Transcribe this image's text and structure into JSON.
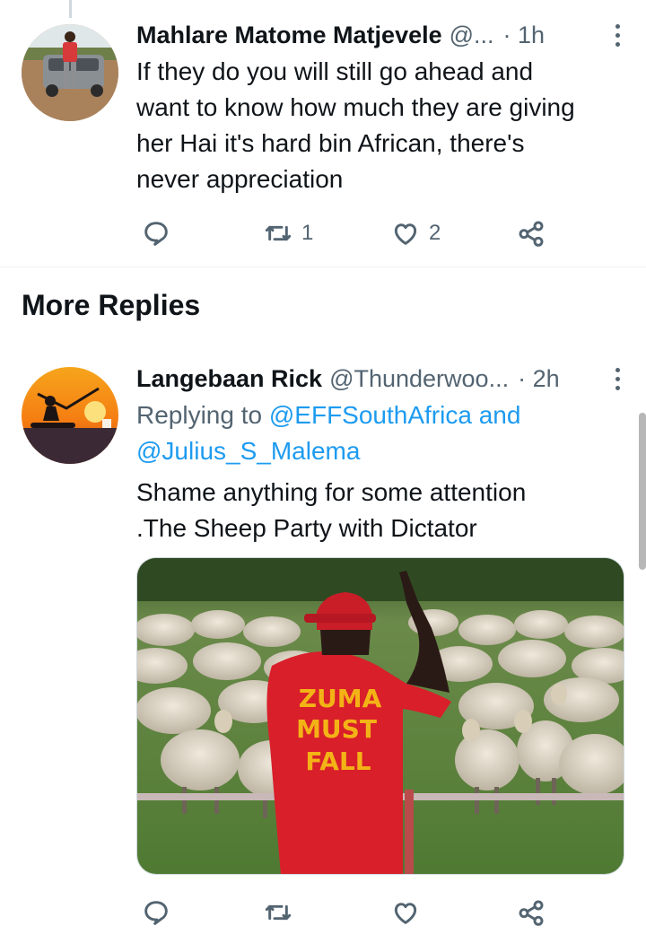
{
  "tweet1": {
    "name": "Mahlare Matome Matjevele",
    "handle": "@...",
    "time": "· 1h",
    "text_lines": [
      "If they do you will still go ahead and",
      "want to know how much they are giving",
      "her Hai it's hard bin African, there's",
      "never appreciation"
    ],
    "retweet_count": "1",
    "like_count": "2"
  },
  "section": {
    "title": "More Replies"
  },
  "tweet2": {
    "name": "Langebaan Rick",
    "handle": "@Thunderwoo...",
    "time": "· 2h",
    "replying_prefix": "Replying to ",
    "replying_user1": "@EFFSouthAfrica",
    "replying_and": " and",
    "replying_user2": "@Julius_S_Malema",
    "text_lines": [
      "Shame anything for some attention",
      ".The Sheep Party with Dictator"
    ],
    "image_shirt_text": [
      "ZUMA",
      "MUST",
      "FALL"
    ]
  },
  "icons": [
    "reply-icon",
    "retweet-icon",
    "like-icon",
    "share-icon",
    "more-icon"
  ],
  "colors": {
    "link": "#1d9bf0",
    "secondary": "#536471",
    "primary": "#0f1419"
  }
}
